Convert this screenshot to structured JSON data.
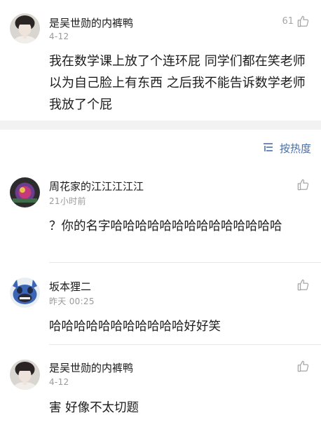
{
  "post": {
    "author": "是吴世勋的内裤鸭",
    "date": "4-12",
    "likes": "61",
    "text": "我在数学课上放了个连环屁 同学们都在笑老师以为自己脸上有东西 之后我不能告诉数学老师我放了个屁"
  },
  "sort": {
    "label": "按热度"
  },
  "comments": [
    {
      "author": "周花家的江江江江江",
      "time": "21小时前",
      "text": "？你的名字哈哈哈哈哈哈哈哈哈哈哈哈哈哈"
    },
    {
      "author": "坂本狸二",
      "time": "昨天 00:25",
      "text": "哈哈哈哈哈哈哈哈哈哈哈好好笑"
    },
    {
      "author": "是吴世勋的内裤鸭",
      "time": "4-12",
      "text": "害 好像不太切题"
    }
  ],
  "colors": {
    "accent": "#4a6fa5",
    "muted": "#9a9a9a",
    "band": "#f2f2f2"
  },
  "icons": {
    "like": "thumbs-up-icon",
    "sort": "sort-lines-icon"
  }
}
